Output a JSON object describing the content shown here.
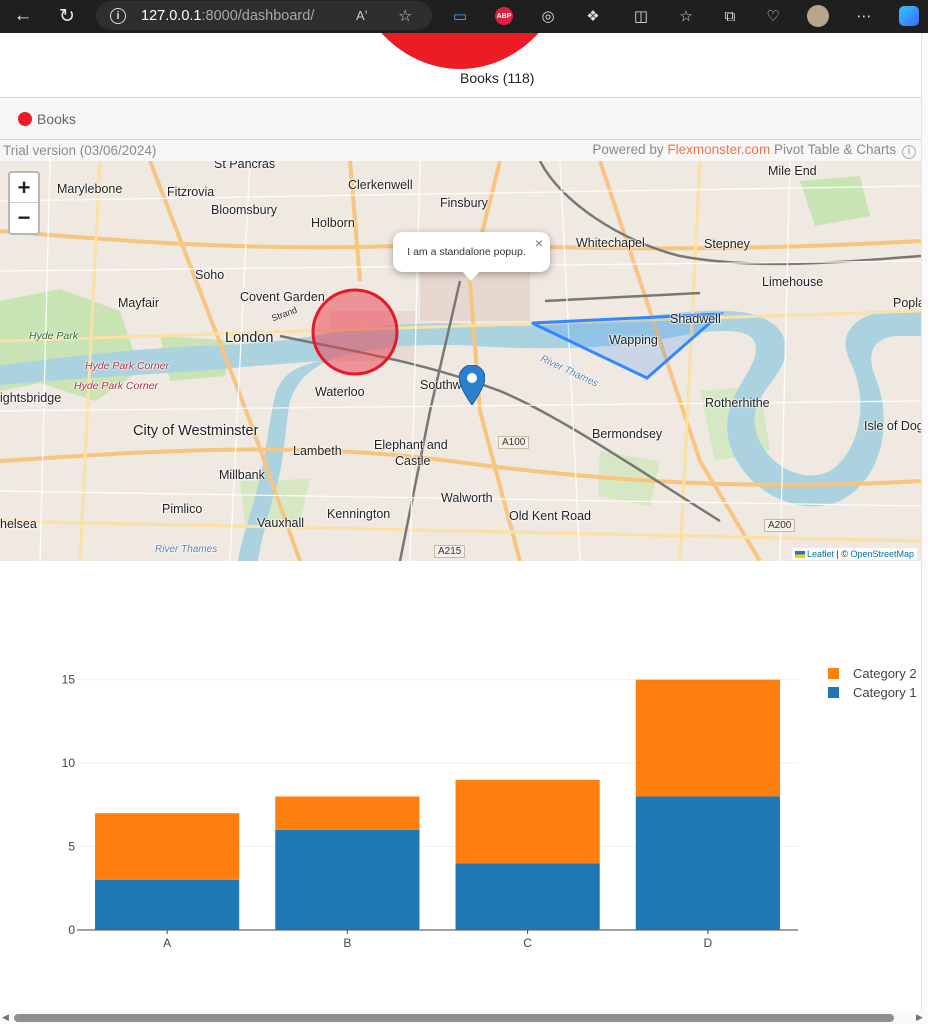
{
  "browser": {
    "url_host": "127.0.0.1",
    "url_path": ":8000/dashboard/",
    "info_glyph": "i",
    "read_aloud_glyph": "Aʼ",
    "abp_label": "ABP"
  },
  "pivot": {
    "pie_label": "Books (118)",
    "legend_label": "Books",
    "trial_text": "Trial version (03/06/2024)",
    "powered_prefix": "Powered by ",
    "powered_brand": "Flexmonster.com",
    "powered_suffix": " Pivot Table & Charts",
    "pie_color": "#ec1c24"
  },
  "map": {
    "zoom_in": "+",
    "zoom_out": "−",
    "popup_text": "I am a standalone popup.",
    "popup_close": "×",
    "attribution_leaflet": "Leaflet",
    "attribution_sep": " | © ",
    "attribution_osm": "OpenStreetMap",
    "labels": {
      "st_pancras": "St Pancras",
      "clerkenwell": "Clerkenwell",
      "mile_end": "Mile End",
      "marylebone": "Marylebone",
      "fitzrovia": "Fitzrovia",
      "finsbury": "Finsbury",
      "bloomsbury": "Bloomsbury",
      "holborn": "Holborn",
      "whitechapel": "Whitechapel",
      "stepney": "Stepney",
      "soho": "Soho",
      "limehouse": "Limehouse",
      "mayfair": "Mayfair",
      "covent_garden": "Covent Garden",
      "poplar": "Popla",
      "shadwell": "Shadwell",
      "hyde_park": "Hyde Park",
      "london": "London",
      "wapping": "Wapping",
      "hyde_park_corner_1": "Hyde Park Corner",
      "hyde_park_corner_2": "Hyde Park Corner",
      "southwark": "Southw",
      "knightsbridge": "ightsbridge",
      "waterloo": "Waterloo",
      "rotherhithe": "Rotherhithe",
      "city_westminster": "City of Westminster",
      "bermondsey": "Bermondsey",
      "isle_of_dogs": "Isle of Dog",
      "a100": "A100",
      "lambeth": "Lambeth",
      "elephant_castle_1": "Elephant and",
      "elephant_castle_2": "Castle",
      "millbank": "Millbank",
      "walworth": "Walworth",
      "pimlico": "Pimlico",
      "kennington": "Kennington",
      "old_kent_road": "Old Kent Road",
      "chelsea": "helsea",
      "vauxhall": "Vauxhall",
      "a200": "A200",
      "a215": "A215",
      "river_thames_1": "River Thames",
      "river_thames_2": "River Thames",
      "strand": "Strand"
    }
  },
  "chart_data": {
    "type": "bar",
    "stacked": true,
    "categories": [
      "A",
      "B",
      "C",
      "D"
    ],
    "series": [
      {
        "name": "Category 1",
        "values": [
          3,
          6,
          4,
          8
        ],
        "color": "#1f77b4"
      },
      {
        "name": "Category 2",
        "values": [
          4,
          2,
          5,
          7
        ],
        "color": "#ff7f0e"
      }
    ],
    "yticks": [
      0,
      5,
      10,
      15
    ],
    "ylim": [
      0,
      15.4
    ],
    "legend_order": [
      "Category 2",
      "Category 1"
    ],
    "legend_position": "top-right"
  }
}
